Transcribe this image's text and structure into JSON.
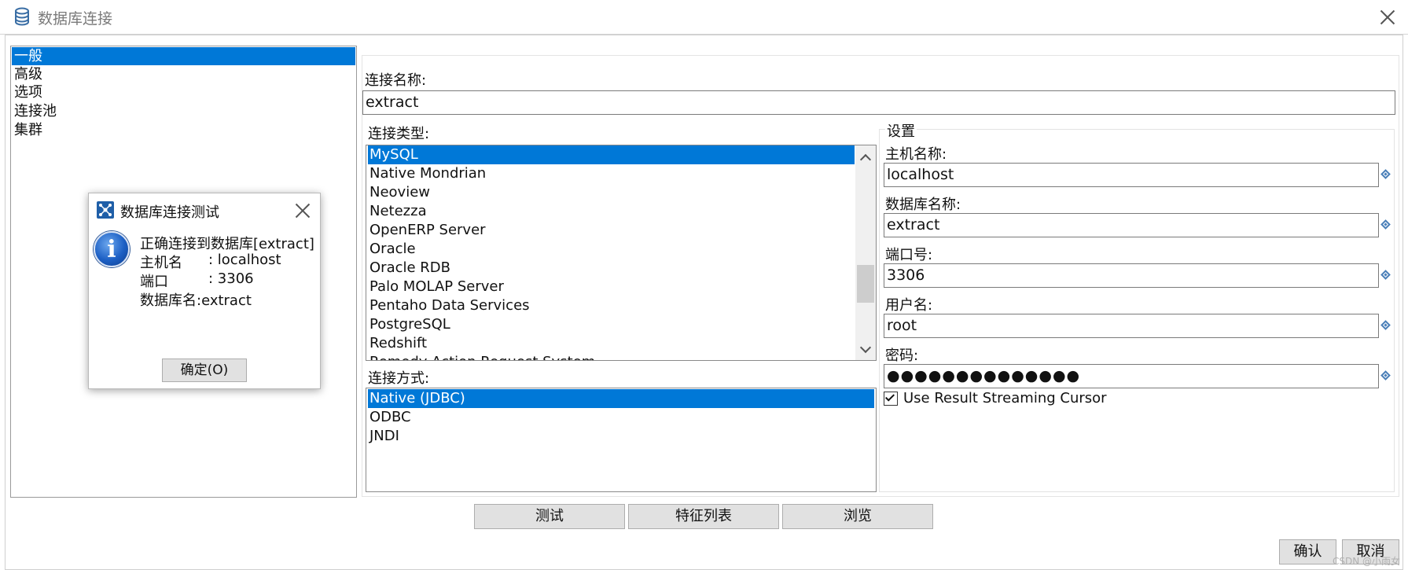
{
  "window": {
    "title": "数据库连接"
  },
  "categories": [
    "一般",
    "高级",
    "选项",
    "连接池",
    "集群"
  ],
  "form": {
    "connection_name_label": "连接名称:",
    "connection_name_value": "extract",
    "connection_type_label": "连接类型:",
    "connection_types": [
      "MySQL",
      "Native Mondrian",
      "Neoview",
      "Netezza",
      "OpenERP Server",
      "Oracle",
      "Oracle RDB",
      "Palo MOLAP Server",
      "Pentaho Data Services",
      "PostgreSQL",
      "Redshift",
      "Remedy Action Request System"
    ],
    "access_label": "连接方式:",
    "access_methods": [
      "Native (JDBC)",
      "ODBC",
      "JNDI"
    ]
  },
  "settings": {
    "group_title": "设置",
    "host_label": "主机名称:",
    "host_value": "localhost",
    "db_label": "数据库名称:",
    "db_value": "extract",
    "port_label": "端口号:",
    "port_value": "3306",
    "user_label": "用户名:",
    "user_value": "root",
    "password_label": "密码:",
    "password_value": "●●●●●●●●●●●●●●",
    "streaming_label": "Use Result Streaming Cursor",
    "streaming_checked": true
  },
  "buttons": {
    "test": "测试",
    "features": "特征列表",
    "explore": "浏览",
    "ok": "确认",
    "cancel": "取消"
  },
  "dialog": {
    "title": "数据库连接测试",
    "message_line1": "正确连接到数据库[extract]",
    "host_key": "主机名",
    "host_val": ": localhost",
    "port_key": "端口",
    "port_val": ": 3306",
    "db_line": "数据库名:extract",
    "ok_button": "确定(O)"
  },
  "watermark": "CSDN @小雨女"
}
